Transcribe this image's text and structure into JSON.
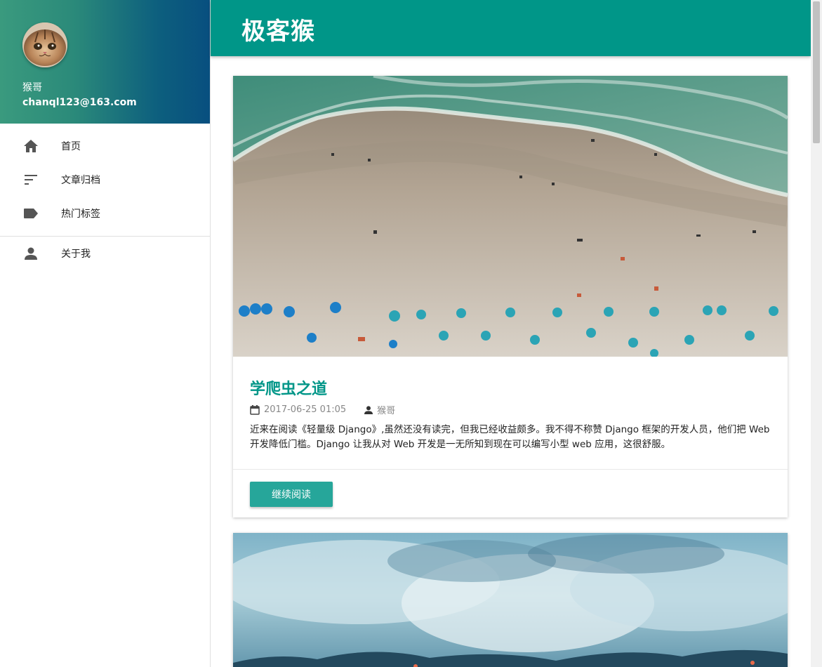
{
  "site": {
    "title": "极客猴"
  },
  "user": {
    "name": "猴哥",
    "email": "chanql123@163.com",
    "avatar_icon": "cat-avatar"
  },
  "nav": {
    "primary": [
      {
        "label": "首页",
        "icon": "home-icon"
      },
      {
        "label": "文章归档",
        "icon": "sort-icon"
      },
      {
        "label": "热门标签",
        "icon": "label-icon"
      }
    ],
    "secondary": [
      {
        "label": "关于我",
        "icon": "person-icon"
      }
    ]
  },
  "posts": [
    {
      "title": "学爬虫之道",
      "date": "2017-06-25 01:05",
      "author": "猴哥",
      "summary": "近来在阅读《轻量级 Django》,虽然还没有读完，但我已经收益颇多。我不得不称赞 Django 框架的开发人员，他们把 Web 开发降低门槛。Django 让我从对 Web 开发是一无所知到现在可以编写小型 web 应用，这很舒服。",
      "read_more": "继续阅读",
      "image": "beach-aerial-photo"
    },
    {
      "image": "volcano-steam-photo"
    }
  ],
  "colors": {
    "primary": "#009688",
    "accent": "#26a69a",
    "header_gradient_start": "#3a9a7e",
    "header_gradient_end": "#084f7f"
  }
}
